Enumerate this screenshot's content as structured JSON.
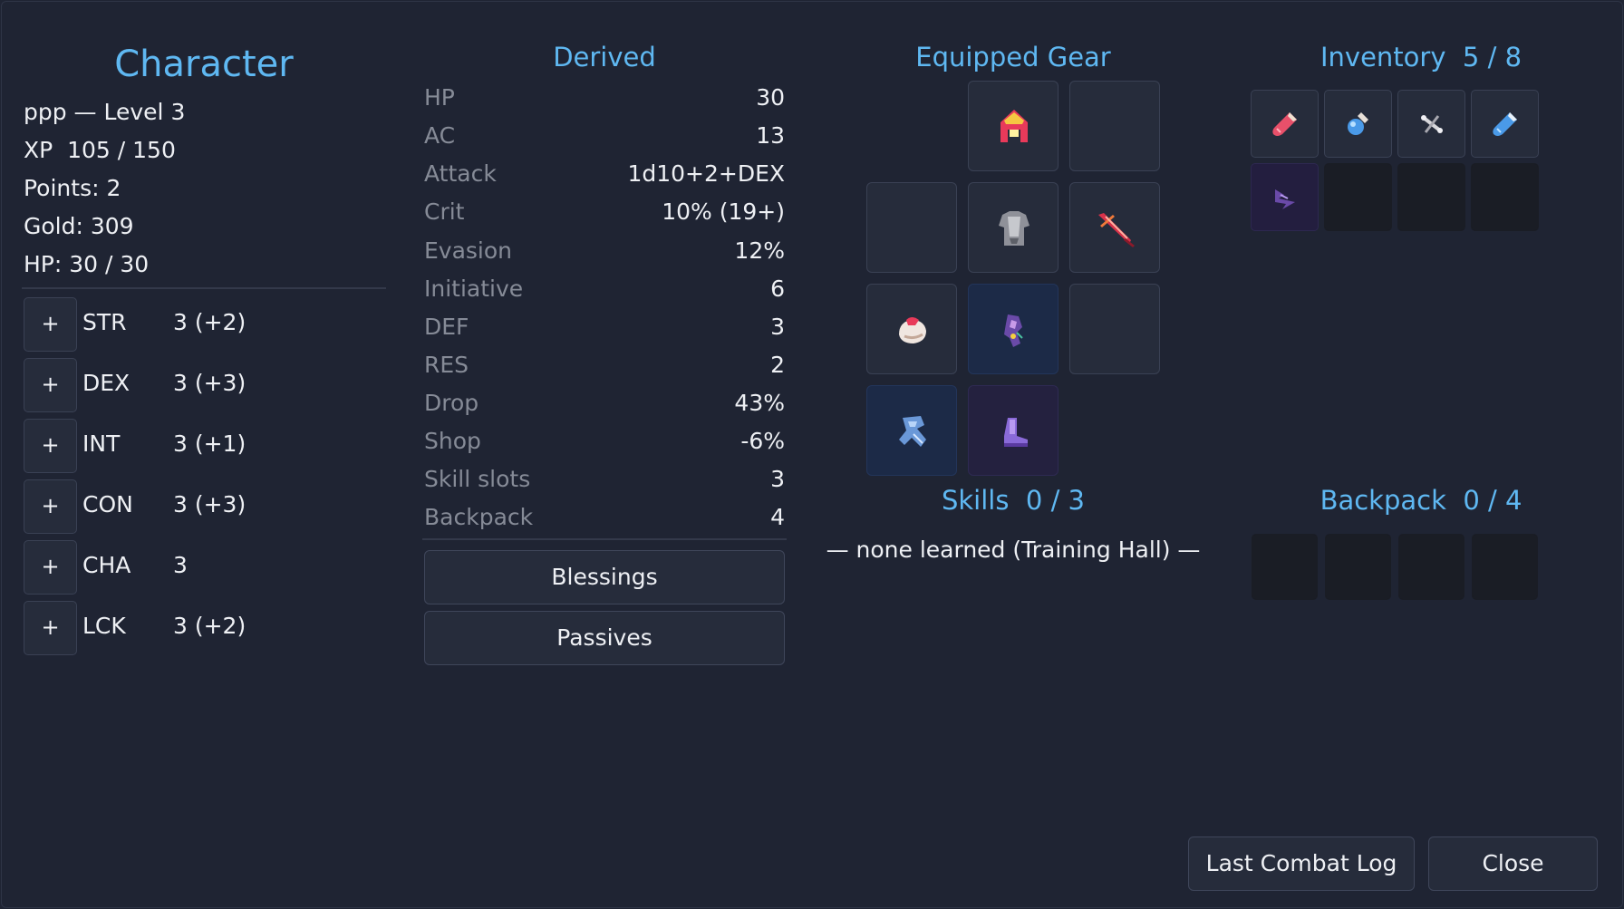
{
  "character": {
    "title": "Character",
    "name_level": "ppp — Level 3",
    "xp": "XP  105 / 150",
    "points": "Points: 2",
    "gold": "Gold: 309",
    "hp": "HP: 30 / 30",
    "plus_label": "+",
    "stats": [
      {
        "name": "STR",
        "value": "3 (+2)"
      },
      {
        "name": "DEX",
        "value": "3 (+3)"
      },
      {
        "name": "INT",
        "value": "3 (+1)"
      },
      {
        "name": "CON",
        "value": "3 (+3)"
      },
      {
        "name": "CHA",
        "value": "3"
      },
      {
        "name": "LCK",
        "value": "3 (+2)"
      }
    ]
  },
  "derived": {
    "title": "Derived",
    "rows": [
      {
        "label": "HP",
        "value": "30"
      },
      {
        "label": "AC",
        "value": "13"
      },
      {
        "label": "Attack",
        "value": "1d10+2+DEX"
      },
      {
        "label": "Crit",
        "value": "10% (19+)"
      },
      {
        "label": "Evasion",
        "value": "12%"
      },
      {
        "label": "Initiative",
        "value": "6"
      },
      {
        "label": "DEF",
        "value": "3"
      },
      {
        "label": "RES",
        "value": "2"
      },
      {
        "label": "Drop",
        "value": "43%"
      },
      {
        "label": "Shop",
        "value": "-6%"
      },
      {
        "label": "Skill slots",
        "value": "3"
      },
      {
        "label": "Backpack",
        "value": "4"
      }
    ],
    "blessings_label": "Blessings",
    "passives_label": "Passives"
  },
  "gear": {
    "title": "Equipped Gear",
    "slots": [
      {
        "item": "helmet-icon",
        "color": "#e83a5a"
      },
      {
        "item": "",
        "color": ""
      },
      {
        "item": "",
        "color": ""
      },
      {
        "item": "chest-armor-icon",
        "color": "#9a9ca3"
      },
      {
        "item": "sword-icon",
        "color": "#d8324a"
      },
      {
        "item": "gloves-icon",
        "color": "#f0e6e0"
      },
      {
        "item": "amulet-icon",
        "color": "#8a6ad0"
      },
      {
        "item": "",
        "color": ""
      },
      {
        "item": "ring-icon",
        "color": "#7aa8e8"
      },
      {
        "item": "boots-icon",
        "color": "#9a7ae0"
      }
    ]
  },
  "inventory": {
    "title": "Inventory  5 / 8",
    "items": [
      "red-potion-icon",
      "blue-potion-icon",
      "bone-icon",
      "mana-vial-icon",
      "shadow-claw-icon",
      "",
      "",
      ""
    ]
  },
  "skills": {
    "title": "Skills  0 / 3",
    "empty_text": "— none learned (Training Hall) —"
  },
  "backpack": {
    "title": "Backpack  0 / 4"
  },
  "footer": {
    "combat_log_label": "Last Combat Log",
    "close_label": "Close"
  }
}
